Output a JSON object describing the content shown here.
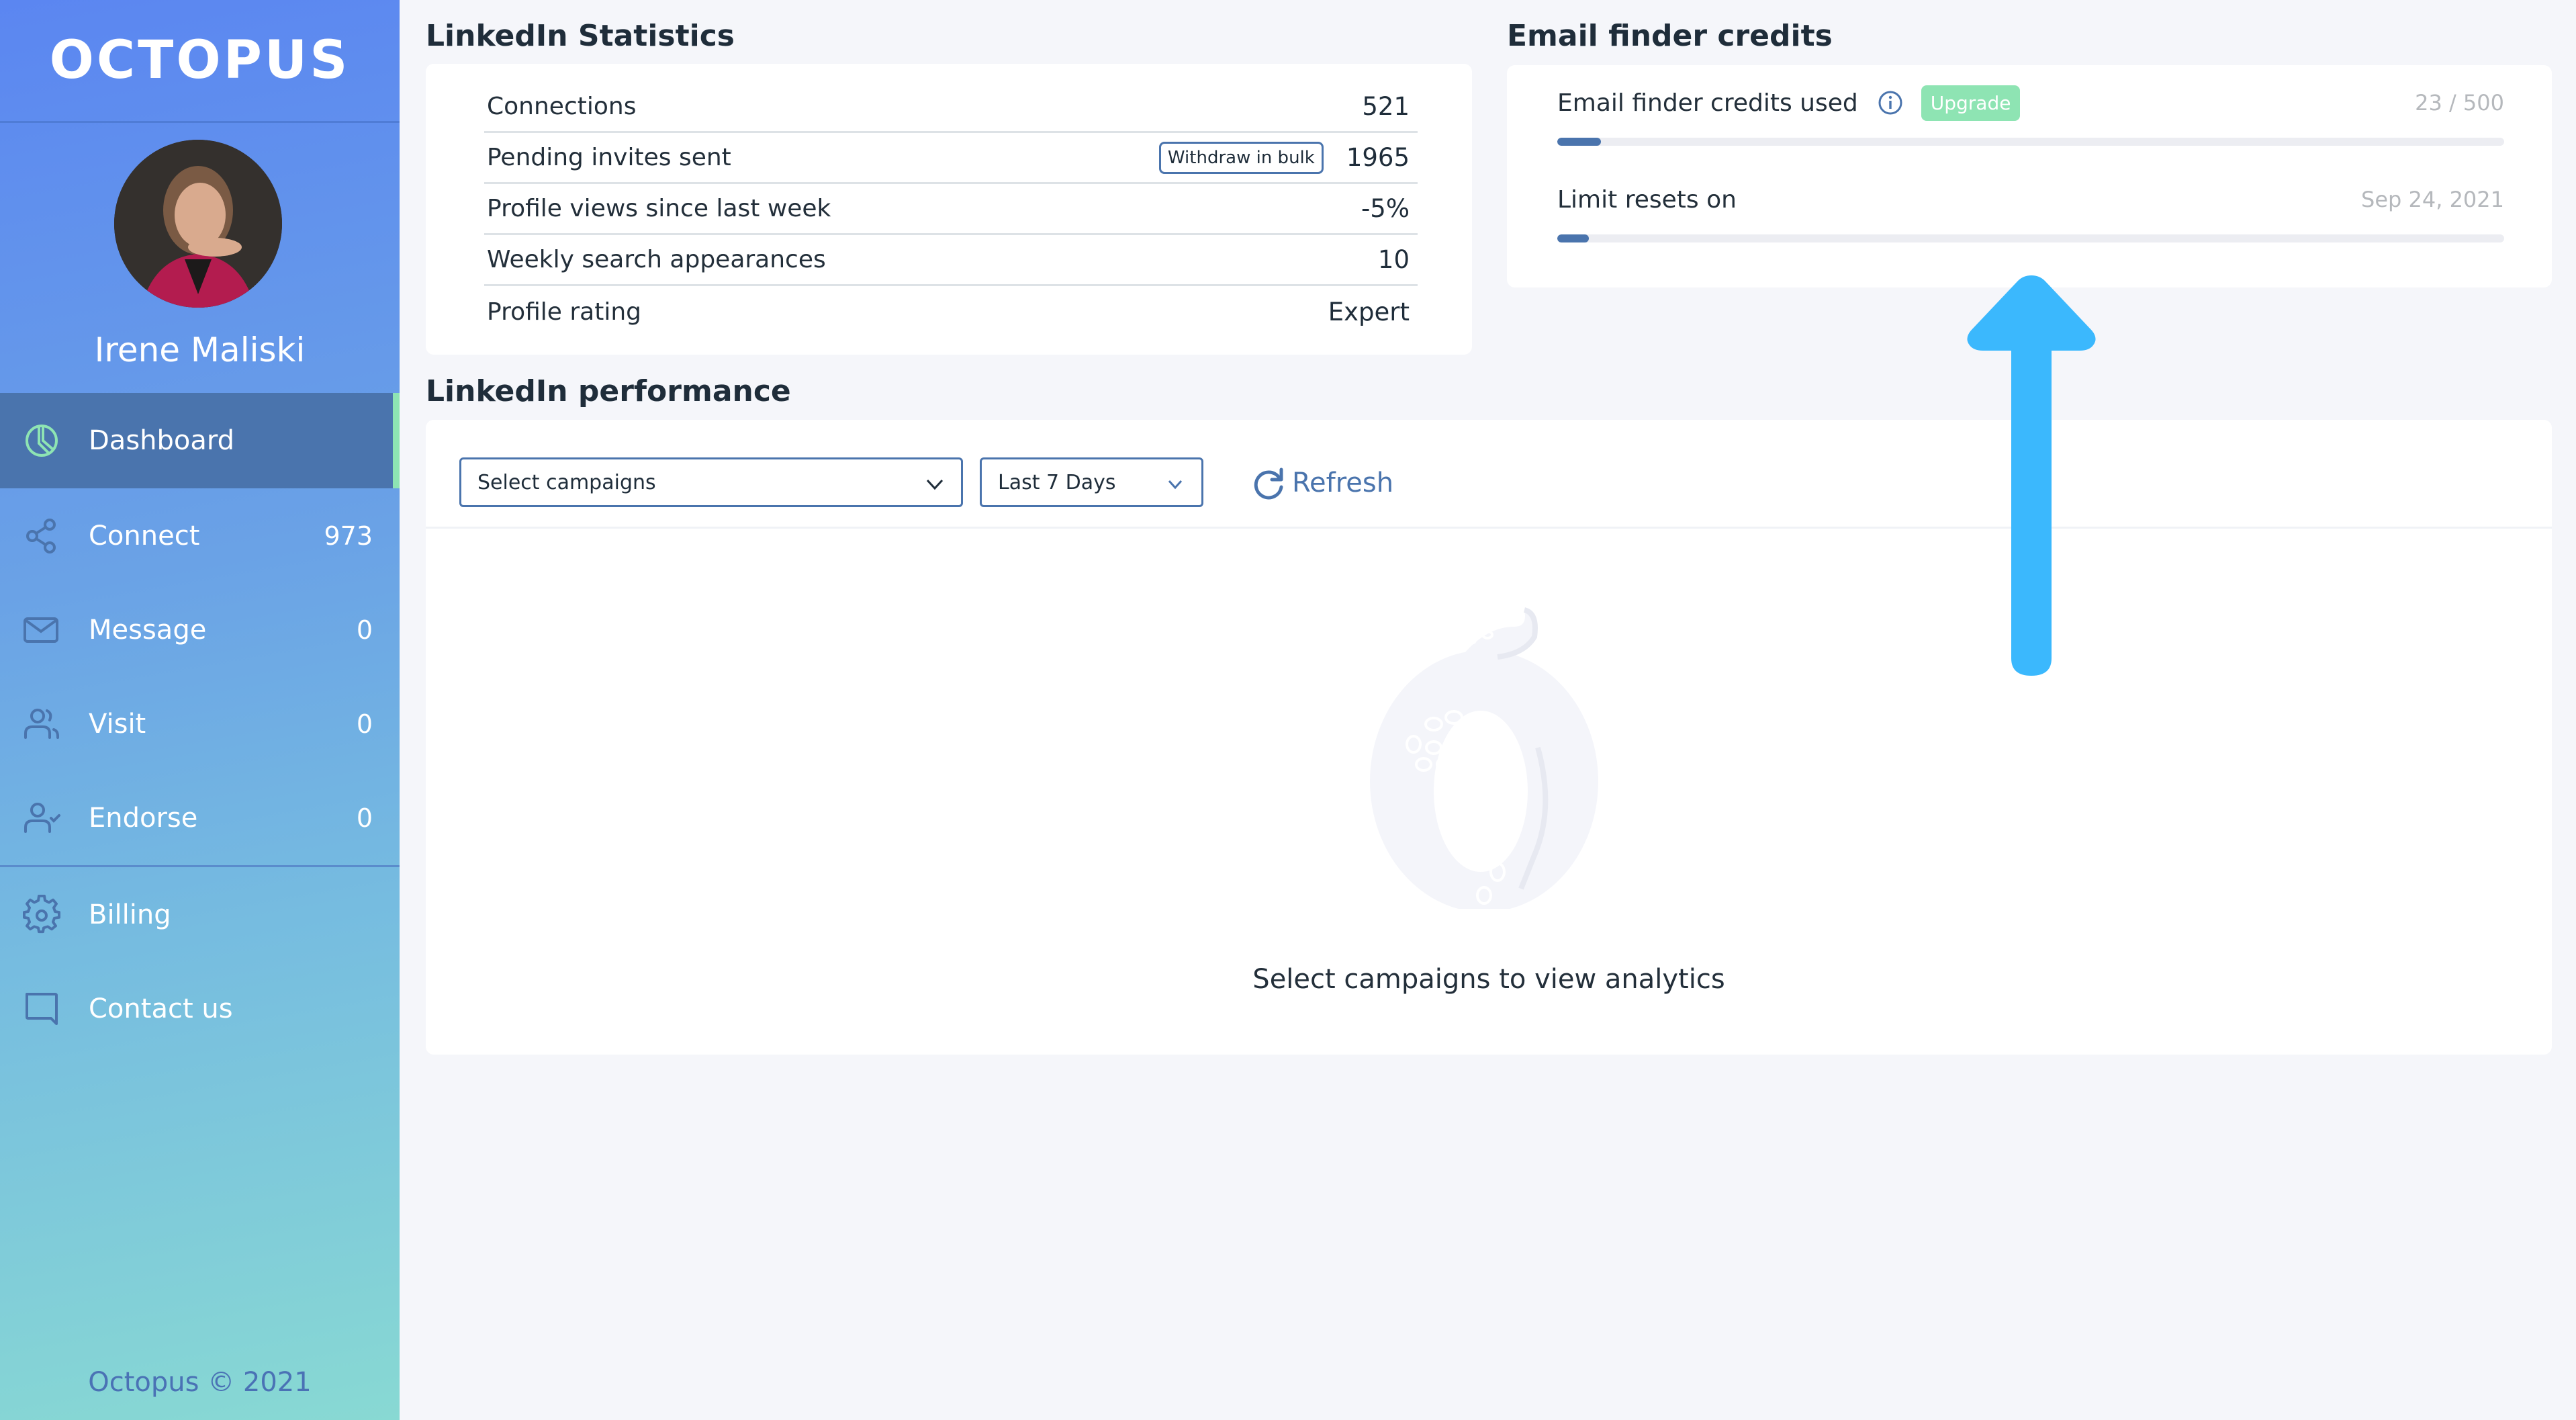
{
  "sidebar": {
    "logo": "OCTOPUS",
    "user": {
      "name": "Irene Maliski"
    },
    "nav": [
      {
        "id": "dashboard",
        "label": "Dashboard",
        "count": "",
        "icon": "pie-chart-icon",
        "active": true
      },
      {
        "id": "connect",
        "label": "Connect",
        "count": "973",
        "icon": "share-icon",
        "active": false
      },
      {
        "id": "message",
        "label": "Message",
        "count": "0",
        "icon": "envelope-icon",
        "active": false
      },
      {
        "id": "visit",
        "label": "Visit",
        "count": "0",
        "icon": "users-icon",
        "active": false
      },
      {
        "id": "endorse",
        "label": "Endorse",
        "count": "0",
        "icon": "user-check-icon",
        "active": false
      },
      {
        "id": "billing",
        "label": "Billing",
        "count": "",
        "icon": "gear-icon",
        "active": false
      },
      {
        "id": "contact",
        "label": "Contact us",
        "count": "",
        "icon": "chat-bubble-icon",
        "active": false
      }
    ],
    "footer": "Octopus © 2021"
  },
  "linkedin_stats": {
    "title": "LinkedIn Statistics",
    "rows": [
      {
        "label": "Connections",
        "value": "521"
      },
      {
        "label": "Pending invites sent",
        "value": "1965",
        "action": "Withdraw in bulk"
      },
      {
        "label": "Profile views since last week",
        "value": "-5%"
      },
      {
        "label": "Weekly search appearances",
        "value": "10"
      },
      {
        "label": "Profile rating",
        "value": "Expert"
      }
    ]
  },
  "email_credits": {
    "title": "Email finder credits",
    "used_label": "Email finder credits used",
    "upgrade_label": "Upgrade",
    "used_value": "23 / 500",
    "used_fraction": 0.046,
    "reset_label": "Limit resets on",
    "reset_value": "Sep 24, 2021",
    "reset_fraction": 0.033
  },
  "performance": {
    "title": "LinkedIn performance",
    "campaign_select": "Select campaigns",
    "range_select": "Last 7 Days",
    "refresh_label": "Refresh",
    "empty_message": "Select campaigns to view analytics"
  },
  "colors": {
    "accent": "#4a74ad",
    "active_indicator": "#8ee4b3",
    "upgrade": "#8ee4b3",
    "annotation_arrow": "#3bb8fd",
    "background": "#f5f6fa"
  }
}
